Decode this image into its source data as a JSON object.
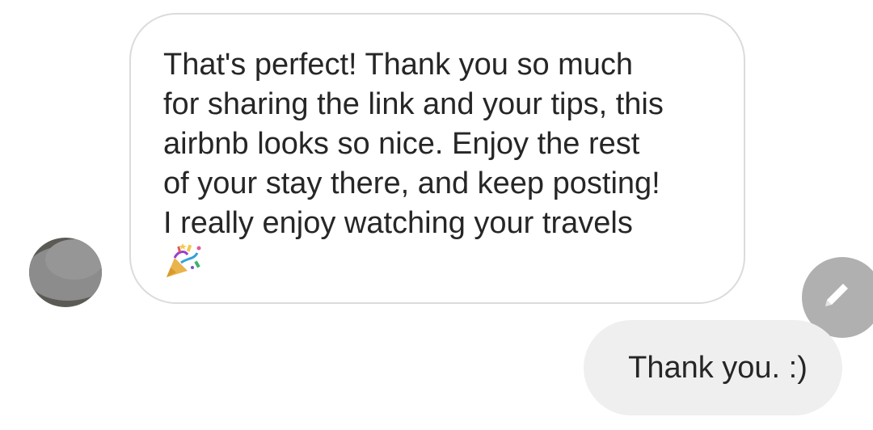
{
  "conversation": {
    "received_message": {
      "text": "That's perfect! Thank you so much\nfor sharing the link and your tips, this\nairbnb looks so nice. Enjoy the rest\nof your stay there, and keep posting!\nI really enjoy watching your travels",
      "emoji_icon": "party-popper-icon"
    },
    "sent_message": {
      "text": "Thank you. :)"
    },
    "sender_avatar": {
      "state": "blurred"
    },
    "edit_button": {
      "icon": "pencil-icon"
    }
  },
  "colors": {
    "background": "#ffffff",
    "received_bubble_border": "#dbdbdb",
    "sent_bubble_bg": "#efefef",
    "text": "#262626",
    "edit_button_bg": "#b0b0b0"
  }
}
